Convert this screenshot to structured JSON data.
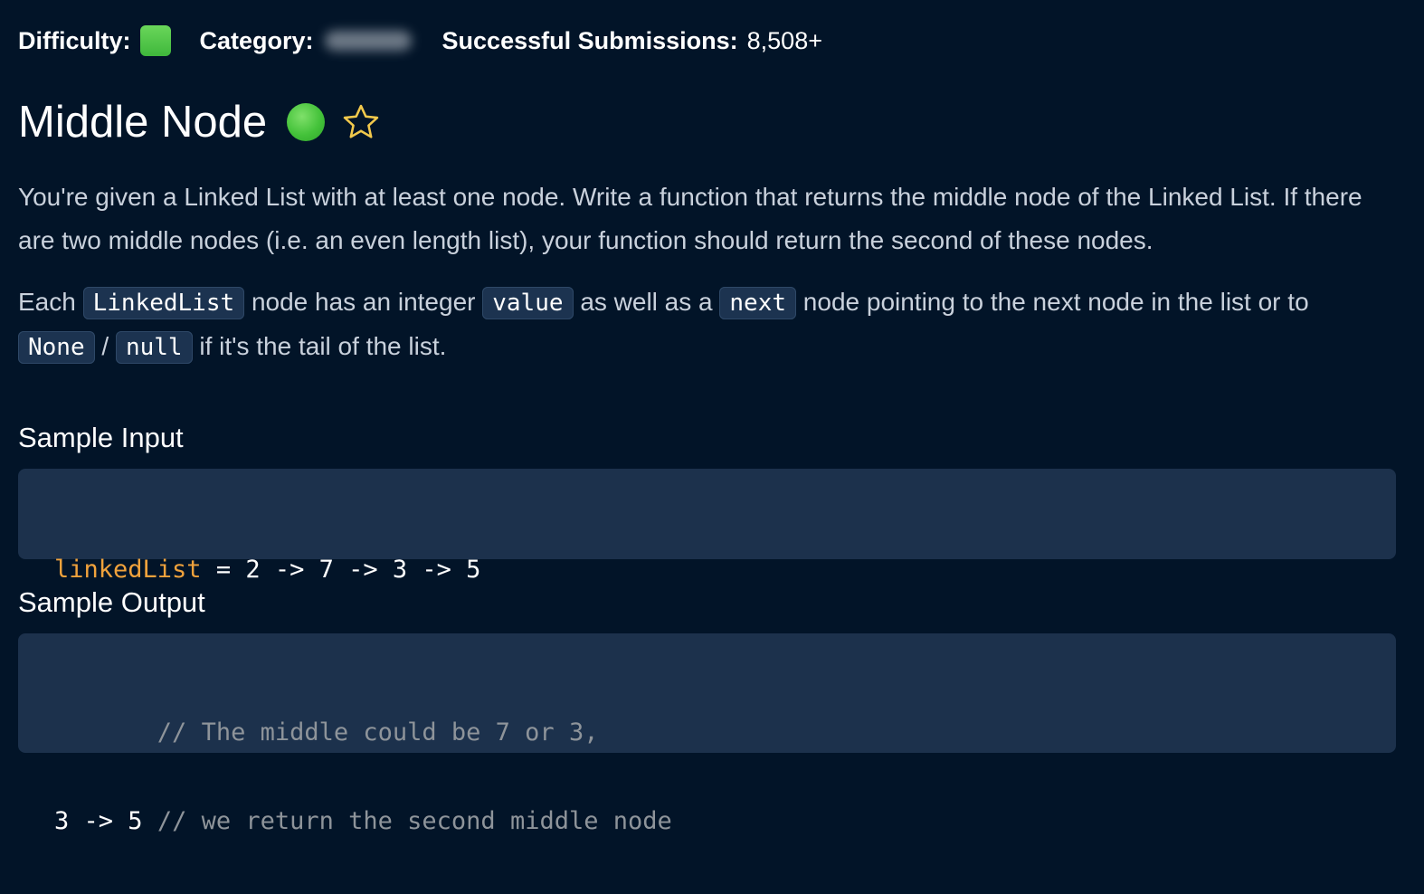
{
  "meta": {
    "difficulty_label": "Difficulty:",
    "category_label": "Category:",
    "submissions_label": "Successful Submissions:",
    "submissions_value": "8,508+",
    "difficulty_color": "#4cc648"
  },
  "problem": {
    "title": "Middle Node",
    "solved_icon": "green-circle-icon",
    "favorite_icon": "star-outline-icon",
    "paragraph1": "You're given a Linked List with at least one node. Write a function that returns the middle node of the Linked List. If there are two middle nodes (i.e. an even length list), your function should return the second of these nodes.",
    "p2": {
      "text1": "Each",
      "code1": "LinkedList",
      "text2": "node has an integer",
      "code2": "value",
      "text3": "as well as a",
      "code3": "next",
      "text4": "node pointing to the next node in the list or to",
      "code4": "None",
      "text5": "/",
      "code5": "null",
      "text6": "if it's the tail of the list."
    }
  },
  "sample_input": {
    "heading": "Sample Input",
    "var": "linkedList",
    "rest": " = 2 -> 7 -> 3 -> 5"
  },
  "sample_output": {
    "heading": "Sample Output",
    "line1_comment": "// The middle could be 7 or 3,",
    "line2_value": "3 -> 5",
    "line2_comment": "// we return the second middle node"
  },
  "colors": {
    "background": "#021428",
    "code_block_bg": "#1c314c",
    "code_variable": "#f0a23c",
    "code_comment": "#8e949a",
    "star": "#f2c94c"
  }
}
